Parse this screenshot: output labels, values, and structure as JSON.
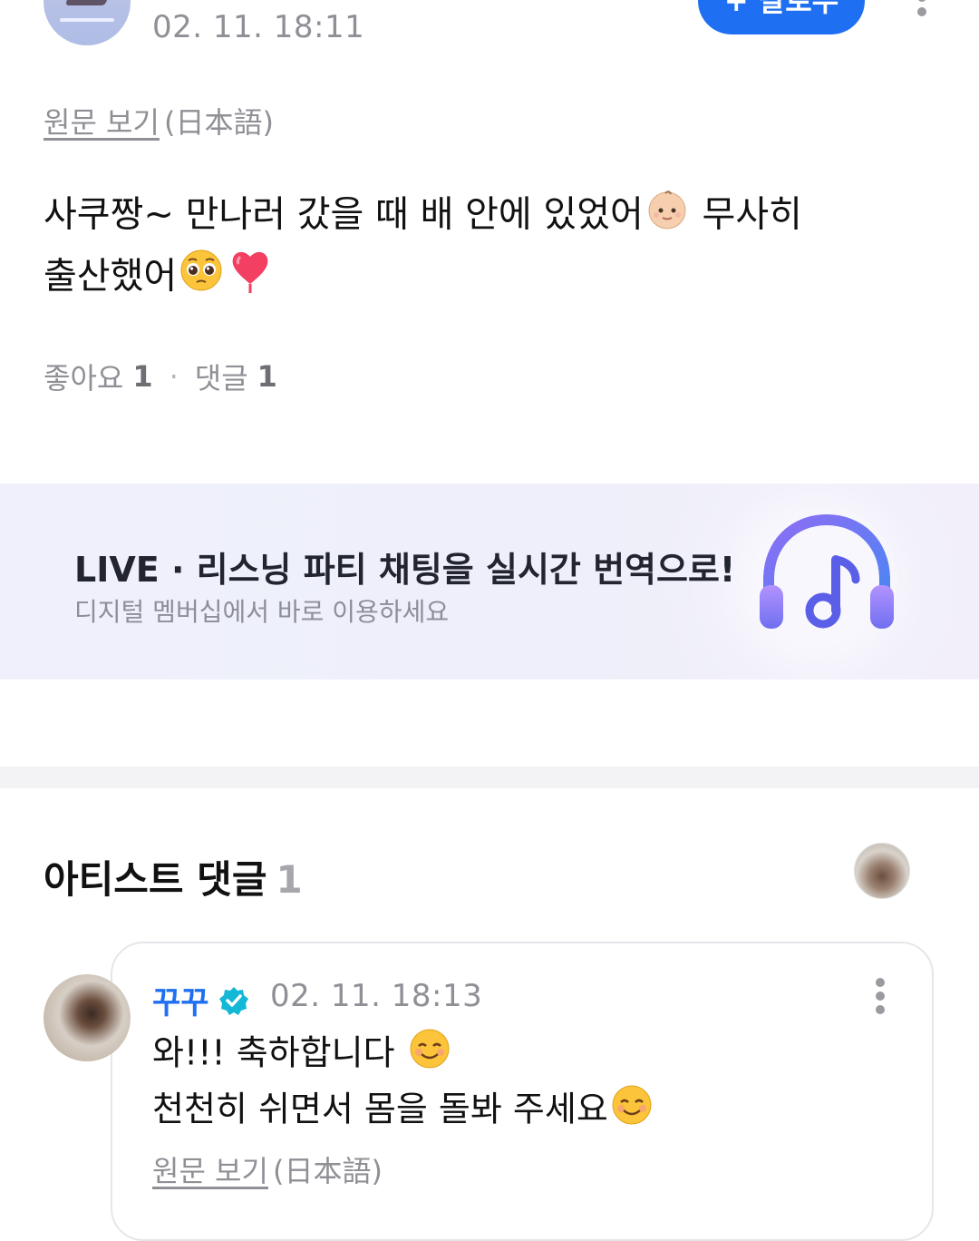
{
  "post": {
    "time": "02. 11. 18:11",
    "follow_label": "+ 팔로우",
    "original_link": "원문 보기",
    "original_lang": "(日本語)",
    "body_line1": "사쿠짱~ 만나러 갔을 때 배 안에 있었어",
    "body_line1_end": " 무사히",
    "body_line2": "출산했어",
    "emoji_icons": [
      "baby-face-emoji",
      "pleading-face-emoji",
      "heart-emoji"
    ],
    "likes_label": "좋아요",
    "likes_count": "1",
    "comments_label": "댓글",
    "comments_count": "1",
    "separator": "·"
  },
  "banner": {
    "title": "LIVE · 리스닝 파티 채팅을 실시간 번역으로!",
    "subtitle": "디지털 멤버십에서 바로 이용하세요",
    "icon": "headphones-music-icon"
  },
  "artist_comments": {
    "title": "아티스트 댓글",
    "count": "1",
    "comment": {
      "author": "꾸꾸",
      "verified_icon": "verified-badge-icon",
      "time": "02. 11. 18:13",
      "line1": "와!!! 축하합니다 ",
      "line2": "천천히 쉬면서 몸을 돌봐 주세요",
      "emoji_icon": "smiling-face-emoji",
      "original_link": "원문 보기",
      "original_lang": "(日本語)"
    }
  },
  "colors": {
    "accent": "#1f6ff2",
    "muted_text": "#8f8f96",
    "banner_bg": "#eff0fb",
    "divider": "#f3f3f5"
  }
}
